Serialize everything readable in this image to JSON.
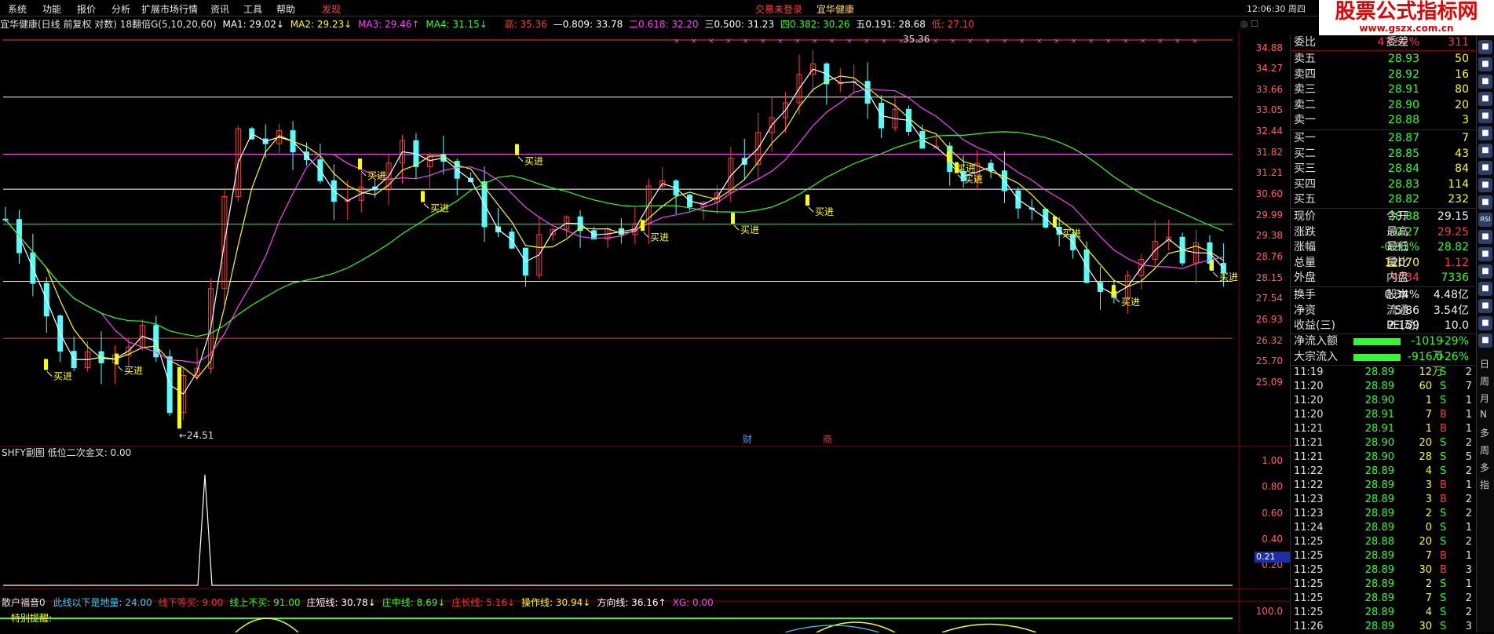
{
  "menu": {
    "items": [
      "系统",
      "功能",
      "报价",
      "分析",
      "扩展市场行情",
      "资讯",
      "工具",
      "帮助",
      "发现"
    ],
    "login_status": "交易未登录",
    "stock_name": "宜华健康",
    "clock": "12:06:30 周四"
  },
  "logo": {
    "title": "股票公式指标网",
    "url": "www.gszx.com.cn"
  },
  "chart_header": {
    "title": "宜华健康(日线 前复权 对数) 18翻倍G(5,10,20,60)",
    "ma1": "MA1: 29.02↓",
    "ma2": "MA2: 29.23↓",
    "ma3": "MA3: 29.46↑",
    "ma4": "MA4: 31.15↓",
    "fib0": "高: 35.36",
    "fib1": "—0.809: 33.78",
    "fib2": "二0.618: 32.20",
    "fib3": "三0.500: 31.23",
    "fib4": "四0.382: 30.26",
    "fib5": "五0.191: 28.68",
    "fib6": "低: 27.10"
  },
  "price_axis": [
    "34.88",
    "34.27",
    "33.66",
    "33.05",
    "32.44",
    "31.82",
    "31.21",
    "30.60",
    "29.99",
    "29.38",
    "28.76",
    "28.15",
    "27.54",
    "26.93",
    "26.32",
    "25.70",
    "25.09"
  ],
  "annotations": {
    "high_label": "35.36",
    "low_label": "←24.51",
    "buy_label": "买进",
    "cai": "财",
    "shang": "商"
  },
  "sub1": {
    "title": "SHFY副图  低位二次金叉: 0.00",
    "axis": [
      "1.00",
      "0.80",
      "0.60",
      "0.40",
      "0.20"
    ],
    "cursor_value": "0.21"
  },
  "sub2": {
    "title": "散户福音0",
    "items": [
      {
        "text": "此线以下是地量: 24.00",
        "color": "#2bd4ff"
      },
      {
        "text": "线下等买: 9.00",
        "color": "#ff3030"
      },
      {
        "text": "线上不买: 91.00",
        "color": "#2bff2b"
      },
      {
        "text": "庄短线: 30.78↓",
        "color": "#ffffff"
      },
      {
        "text": "庄中线: 8.69↓",
        "color": "#2bff2b"
      },
      {
        "text": "庄长线: 5.16↓",
        "color": "#ff3030"
      },
      {
        "text": "操作线: 30.94↓",
        "color": "#ffff00"
      },
      {
        "text": "方向线: 36.16↑",
        "color": "#ffffff"
      },
      {
        "text": "XG: 0.00",
        "color": "#ff40ff"
      }
    ],
    "alert": "特别提醒:",
    "axis_top": "100.0"
  },
  "quote": {
    "weibi": {
      "label": "委比",
      "value": "47.52%",
      "label2": "委差",
      "value2": "311"
    },
    "asks": [
      {
        "label": "卖五",
        "price": "28.93",
        "vol": "50"
      },
      {
        "label": "卖四",
        "price": "28.92",
        "vol": "16"
      },
      {
        "label": "卖三",
        "price": "28.91",
        "vol": "80"
      },
      {
        "label": "卖二",
        "price": "28.90",
        "vol": "20"
      },
      {
        "label": "卖一",
        "price": "28.88",
        "vol": "3"
      }
    ],
    "bids": [
      {
        "label": "买一",
        "price": "28.87",
        "vol": "7"
      },
      {
        "label": "买二",
        "price": "28.85",
        "vol": "43"
      },
      {
        "label": "买三",
        "price": "28.84",
        "vol": "84"
      },
      {
        "label": "买四",
        "price": "28.83",
        "vol": "114"
      },
      {
        "label": "买五",
        "price": "28.82",
        "vol": "232"
      }
    ],
    "stats": [
      {
        "l1": "现价",
        "v1": "28.88",
        "c1": "grn",
        "l2": "今开",
        "v2": "29.15",
        "c2": "wht"
      },
      {
        "l1": "涨跌",
        "v1": "-0.27",
        "c1": "grn",
        "l2": "最高",
        "v2": "29.25",
        "c2": "red"
      },
      {
        "l1": "涨幅",
        "v1": "-0.93%",
        "c1": "grn",
        "l2": "最低",
        "v2": "28.82",
        "c2": "grn"
      },
      {
        "l1": "总量",
        "v1": "12070",
        "c1": "yel",
        "l2": "量比",
        "v2": "1.12",
        "c2": "red"
      },
      {
        "l1": "外盘",
        "v1": "4734",
        "c1": "red",
        "l2": "内盘",
        "v2": "7336",
        "c2": "grn"
      }
    ],
    "fin": [
      {
        "l1": "换手",
        "v1": "0.34%",
        "l2": "股本",
        "v2": "4.48亿"
      },
      {
        "l1": "净资",
        "v1": "5.86",
        "l2": "流通",
        "v2": "3.54亿"
      },
      {
        "l1": "收益(三)",
        "v1": "2.159",
        "l2": "PE(动)",
        "v2": "10.0"
      }
    ],
    "flows": [
      {
        "label": "净流入额",
        "value": "-1019万",
        "pct": "-29%"
      },
      {
        "label": "大宗流入",
        "value": "-916.0万",
        "pct": "-26%"
      }
    ],
    "ticks": [
      {
        "t": "11:19",
        "p": "28.89",
        "q": "12",
        "s": "S",
        "c": "2"
      },
      {
        "t": "11:20",
        "p": "28.89",
        "q": "60",
        "s": "S",
        "c": "7"
      },
      {
        "t": "11:20",
        "p": "28.90",
        "q": "1",
        "s": "S",
        "c": "1"
      },
      {
        "t": "11:20",
        "p": "28.91",
        "q": "7",
        "s": "B",
        "c": "1"
      },
      {
        "t": "11:21",
        "p": "28.91",
        "q": "1",
        "s": "B",
        "c": "1"
      },
      {
        "t": "11:21",
        "p": "28.90",
        "q": "20",
        "s": "S",
        "c": "2"
      },
      {
        "t": "11:21",
        "p": "28.90",
        "q": "28",
        "s": "S",
        "c": "5"
      },
      {
        "t": "11:22",
        "p": "28.89",
        "q": "4",
        "s": "S",
        "c": "2"
      },
      {
        "t": "11:22",
        "p": "28.89",
        "q": "3",
        "s": "B",
        "c": "1"
      },
      {
        "t": "11:23",
        "p": "28.89",
        "q": "3",
        "s": "B",
        "c": "2"
      },
      {
        "t": "11:23",
        "p": "28.89",
        "q": "2",
        "s": "S",
        "c": "2"
      },
      {
        "t": "11:24",
        "p": "28.89",
        "q": "0",
        "s": "S",
        "c": "1"
      },
      {
        "t": "11:25",
        "p": "28.88",
        "q": "20",
        "s": "S",
        "c": "2"
      },
      {
        "t": "11:25",
        "p": "28.89",
        "q": "7",
        "s": "B",
        "c": "1"
      },
      {
        "t": "11:25",
        "p": "28.89",
        "q": "30",
        "s": "B",
        "c": "3"
      },
      {
        "t": "11:25",
        "p": "28.89",
        "q": "2",
        "s": "S",
        "c": "1"
      },
      {
        "t": "11:25",
        "p": "28.89",
        "q": "7",
        "s": "S",
        "c": "2"
      },
      {
        "t": "11:25",
        "p": "28.89",
        "q": "4",
        "s": "S",
        "c": "2"
      },
      {
        "t": "11:26",
        "p": "28.89",
        "q": "30",
        "s": "S",
        "c": "3"
      }
    ]
  },
  "strip_text": [
    "日",
    "周",
    "月",
    "N",
    "多",
    "周",
    "多",
    "指"
  ],
  "colors": {
    "up": "#ff3a3a",
    "down": "#54ffff",
    "ma1": "#ffffff",
    "ma2": "#ffff00",
    "ma3": "#ff40ff",
    "ma4": "#2bff2b",
    "buy": "#ffff00",
    "grid": "#8b0000"
  }
}
